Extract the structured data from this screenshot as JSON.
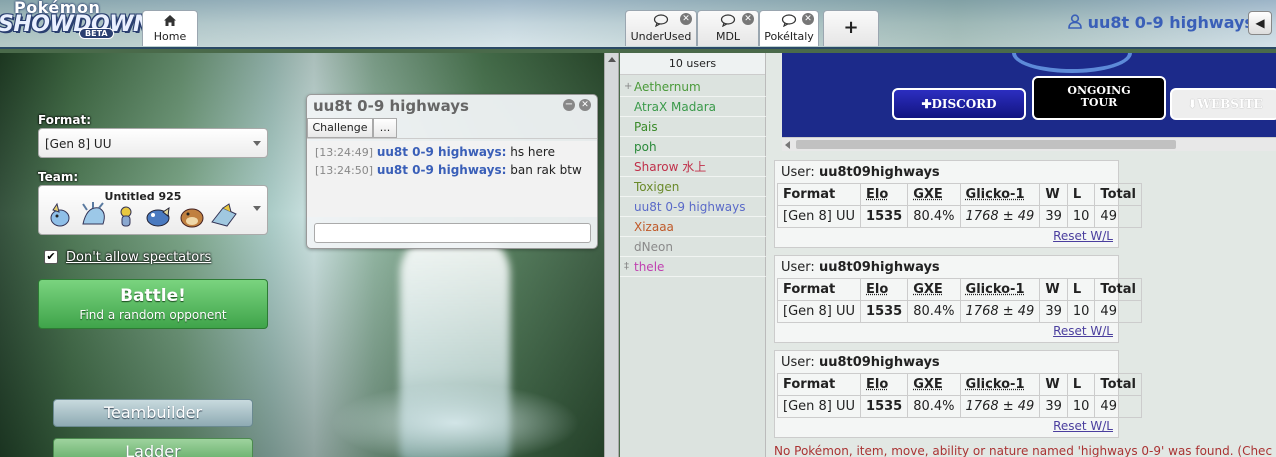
{
  "header": {
    "logo_top": "Pokémon",
    "logo_main": "SHOWDOWN",
    "logo_beta": "BETA",
    "home_tab": "Home",
    "room_tabs": [
      {
        "label": "UnderUsed"
      },
      {
        "label": "MDL"
      },
      {
        "label": "PokéItaly"
      }
    ],
    "add_tab": "+",
    "username": "uu8t 0-9 highways",
    "sound_icon": "speaker-icon"
  },
  "home": {
    "format_label": "Format:",
    "format_value": "[Gen 8] UU",
    "team_label": "Team:",
    "team_name": "Untitled 925",
    "spectators_label": "Don't allow spectators",
    "spectators_checked": true,
    "battle_title": "Battle!",
    "battle_sub": "Find a random opponent",
    "teambuilder": "Teambuilder",
    "ladder": "Ladder"
  },
  "pm": {
    "title": "uu8t 0-9 highways",
    "buttons": [
      "Challenge",
      "..."
    ],
    "messages": [
      {
        "time": "[13:24:49]",
        "user": "uu8t 0-9 highways:",
        "text": "hs here"
      },
      {
        "time": "[13:24:50]",
        "user": "uu8t 0-9 highways:",
        "text": "ban rak btw"
      }
    ]
  },
  "userlist": {
    "count": "10 users",
    "users": [
      {
        "sym": "+",
        "name": "Aethernum",
        "color": "#4a9a3a"
      },
      {
        "sym": "",
        "name": "AtraX Madara",
        "color": "#3a9a4a"
      },
      {
        "sym": "",
        "name": "Pais",
        "color": "#3a8a2a"
      },
      {
        "sym": "",
        "name": "poh",
        "color": "#2a8a3a"
      },
      {
        "sym": "",
        "name": "Sharow 水上",
        "color": "#c0304a"
      },
      {
        "sym": "",
        "name": "Toxigen",
        "color": "#6a8a2a"
      },
      {
        "sym": "",
        "name": "uu8t 0-9 highways",
        "color": "#5a6ac8"
      },
      {
        "sym": "",
        "name": "Xizaaa",
        "color": "#c05a2a"
      },
      {
        "sym": "",
        "name": "dNeon",
        "color": "#8a8a8a"
      },
      {
        "sym": "‡",
        "name": "thele",
        "color": "#c040b0"
      }
    ]
  },
  "banner": {
    "discord": "✚DISCORD",
    "tour_line1": "ONGOING",
    "tour_line2": "TOUR",
    "website": "⬇WEBSITE"
  },
  "rank_cards": [
    {
      "user_label": "User:",
      "user": "uu8t09highways",
      "headers": [
        "Format",
        "Elo",
        "GXE",
        "Glicko-1",
        "W",
        "L",
        "Total"
      ],
      "row": {
        "format": "[Gen 8] UU",
        "elo": "1535",
        "gxe": "80.4%",
        "glicko": "1768 ± 49",
        "w": "39",
        "l": "10",
        "total": "49"
      },
      "reset": "Reset W/L"
    },
    {
      "user_label": "User:",
      "user": "uu8t09highways",
      "headers": [
        "Format",
        "Elo",
        "GXE",
        "Glicko-1",
        "W",
        "L",
        "Total"
      ],
      "row": {
        "format": "[Gen 8] UU",
        "elo": "1535",
        "gxe": "80.4%",
        "glicko": "1768 ± 49",
        "w": "39",
        "l": "10",
        "total": "49"
      },
      "reset": "Reset W/L"
    },
    {
      "user_label": "User:",
      "user": "uu8t09highways",
      "headers": [
        "Format",
        "Elo",
        "GXE",
        "Glicko-1",
        "W",
        "L",
        "Total"
      ],
      "row": {
        "format": "[Gen 8] UU",
        "elo": "1535",
        "gxe": "80.4%",
        "glicko": "1768 ± 49",
        "w": "39",
        "l": "10",
        "total": "49"
      },
      "reset": "Reset W/L"
    }
  ],
  "error": "No Pokémon, item, move, ability or nature named 'highways 0-9' was found. (Chec"
}
